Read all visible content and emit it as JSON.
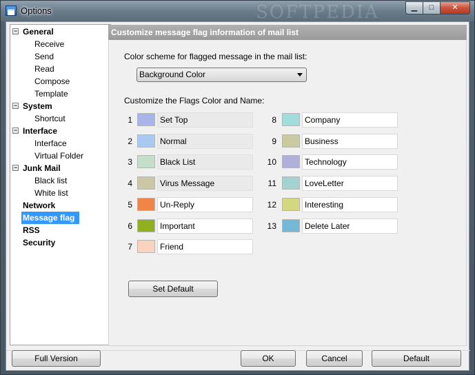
{
  "window": {
    "title": "Options",
    "watermark": "SOFTPEDIA",
    "minimize_glyph": "▁",
    "maximize_glyph": "□",
    "close_glyph": "✕"
  },
  "tree": {
    "expander_glyph": "−",
    "groups": [
      {
        "label": "General",
        "children": [
          "Receive",
          "Send",
          "Read",
          "Compose",
          "Template"
        ]
      },
      {
        "label": "System",
        "children": [
          "Shortcut"
        ]
      },
      {
        "label": "Interface",
        "children": [
          "Interface",
          "Virtual Folder"
        ]
      },
      {
        "label": "Junk Mail",
        "children": [
          "Black list",
          "White list"
        ]
      }
    ],
    "leaves": [
      "Network",
      "Message flag",
      "RSS",
      "Security"
    ],
    "selected": "Message flag"
  },
  "page": {
    "header": "Customize message flag information of mail list",
    "color_scheme_label": "Color scheme for flagged message in the mail list:",
    "color_scheme_value": "Background Color",
    "flags_label": "Customize the Flags Color and Name:",
    "set_default_label": "Set Default"
  },
  "flags": [
    {
      "num": "1",
      "name": "Set Top",
      "color": "#a8b4ea",
      "readonly": true
    },
    {
      "num": "2",
      "name": "Normal",
      "color": "#a9c9f0",
      "readonly": true
    },
    {
      "num": "3",
      "name": "Black List",
      "color": "#c3dec9",
      "readonly": true
    },
    {
      "num": "4",
      "name": "Virus Message",
      "color": "#cbc7a5",
      "readonly": true
    },
    {
      "num": "5",
      "name": "Un-Reply",
      "color": "#ef8547",
      "readonly": false
    },
    {
      "num": "6",
      "name": "Important",
      "color": "#8fb11e",
      "readonly": false
    },
    {
      "num": "7",
      "name": "Friend",
      "color": "#fbd2bd",
      "readonly": false
    },
    {
      "num": "8",
      "name": "Company",
      "color": "#a3dcdc",
      "readonly": false
    },
    {
      "num": "9",
      "name": "Business",
      "color": "#c9c9a2",
      "readonly": false
    },
    {
      "num": "10",
      "name": "Technology",
      "color": "#b0b0dc",
      "readonly": false
    },
    {
      "num": "11",
      "name": "LoveLetter",
      "color": "#a3d2d2",
      "readonly": false
    },
    {
      "num": "12",
      "name": "Interesting",
      "color": "#d2d780",
      "readonly": false
    },
    {
      "num": "13",
      "name": "Delete Later",
      "color": "#73b9d7",
      "readonly": false
    }
  ],
  "buttons": {
    "full_version": "Full Version",
    "ok": "OK",
    "cancel": "Cancel",
    "default": "Default"
  },
  "colors": {
    "selection": "#3399ff",
    "header_bg": "#a6a6a6"
  }
}
